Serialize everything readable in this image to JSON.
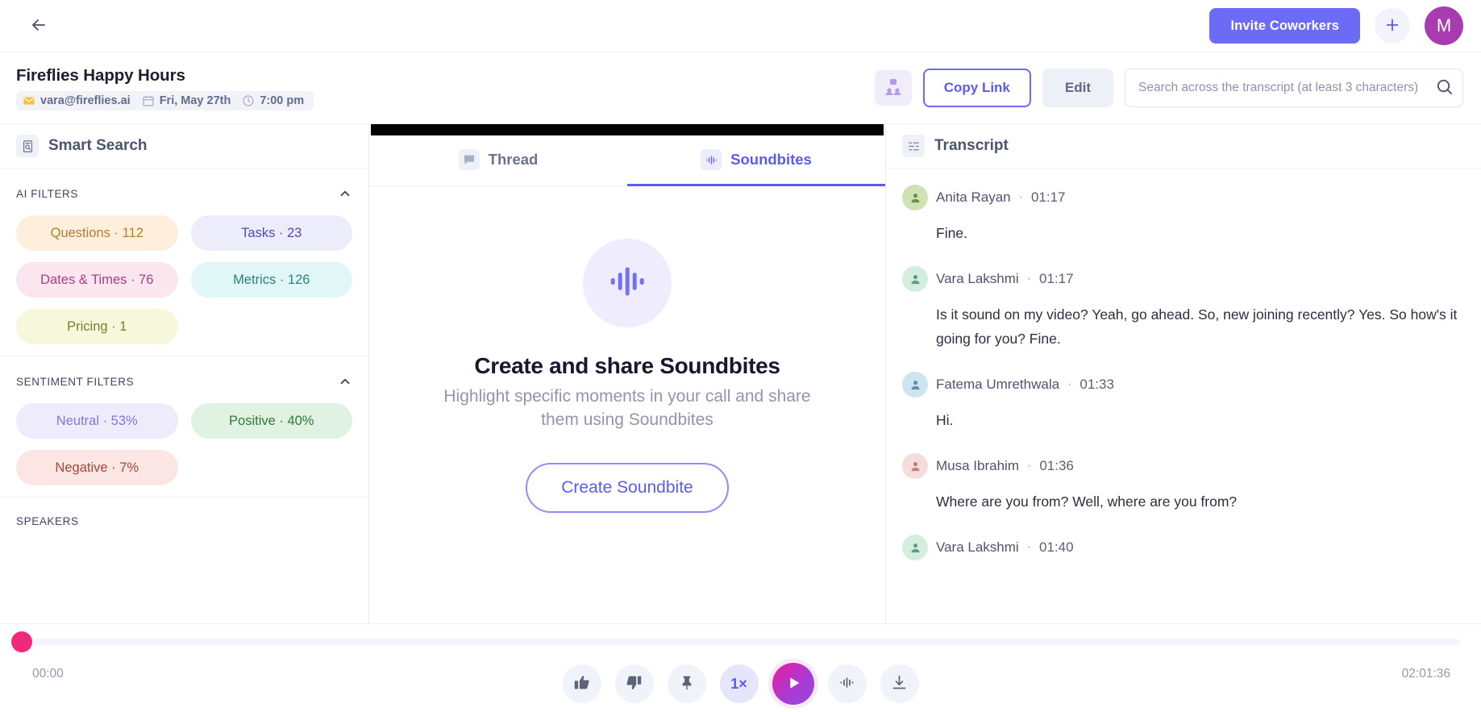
{
  "topbar": {
    "back_icon": "arrow-left-icon",
    "invite_label": "Invite Coworkers",
    "plus_icon": "plus-icon",
    "avatar_initial": "M",
    "accent": "#6b6bf5",
    "avatar_color": "#a93bb0"
  },
  "meeting": {
    "title": "Fireflies Happy Hours",
    "meta": [
      {
        "icon": "envelope-icon",
        "text": "vara@fireflies.ai"
      },
      {
        "icon": "calendar-icon",
        "text": "Fri, May 27th"
      },
      {
        "icon": "clock-icon",
        "text": "7:00 pm"
      }
    ],
    "share_icon": "share-people-icon",
    "copy_link_label": "Copy Link",
    "edit_label": "Edit",
    "search": {
      "placeholder": "Search across the transcript (at least 3 characters)",
      "value": "",
      "icon": "search-icon"
    }
  },
  "sidebar": {
    "header": {
      "icon": "smart-search-icon",
      "title": "Smart Search"
    },
    "sections": [
      {
        "label": "AI FILTERS",
        "chevron": "chevron-up-icon",
        "chips": [
          {
            "label": "Questions · 112",
            "bg": "#fdefdc",
            "fg": "#b1802f"
          },
          {
            "label": "Tasks · 23",
            "bg": "#ececfa",
            "fg": "#514bb5"
          },
          {
            "label": "Dates & Times · 76",
            "bg": "#fbe6f0",
            "fg": "#a6417c"
          },
          {
            "label": "Metrics · 126",
            "bg": "#e1f7f7",
            "fg": "#2f7d7d"
          },
          {
            "label": "Pricing · 1",
            "bg": "#f6f7db",
            "fg": "#7b7d2b"
          }
        ]
      },
      {
        "label": "SENTIMENT FILTERS",
        "chevron": "chevron-up-icon",
        "chips": [
          {
            "label": "Neutral · 53%",
            "bg": "#eeecfb",
            "fg": "#7a7ae0"
          },
          {
            "label": "Positive · 40%",
            "bg": "#e0f2e2",
            "fg": "#2f7a3c"
          },
          {
            "label": "Negative · 7%",
            "bg": "#fce6e4",
            "fg": "#a4453b"
          }
        ]
      },
      {
        "label": "SPEAKERS",
        "chevron": "chevron-up-icon",
        "chips": []
      }
    ]
  },
  "center": {
    "tabs": [
      {
        "label": "Thread",
        "icon": "thread-icon",
        "active": false
      },
      {
        "label": "Soundbites",
        "icon": "soundbite-waveform-icon",
        "active": true
      }
    ],
    "empty": {
      "icon": "soundbite-waveform-icon",
      "title": "Create and share Soundbites",
      "subtitle": "Highlight specific moments in your call and share them using Soundbites",
      "button_label": "Create Soundbite"
    }
  },
  "transcript": {
    "header": {
      "icon": "transcript-lines-icon",
      "title": "Transcript"
    },
    "entries": [
      {
        "speaker": "Anita Rayan",
        "time": "01:17",
        "text": "Fine.",
        "avatar_bg": "#cfe3b2",
        "avatar_fg": "#6f8d4c"
      },
      {
        "speaker": "Vara Lakshmi",
        "time": "01:17",
        "text": "Is it sound on my video? Yeah, go ahead. So, new joining recently? Yes. So how's it going for you? Fine.",
        "avatar_bg": "#d3eede",
        "avatar_fg": "#5f9c80"
      },
      {
        "speaker": "Fatema Umrethwala",
        "time": "01:33",
        "text": "Hi.",
        "avatar_bg": "#cde5ef",
        "avatar_fg": "#5b90a6"
      },
      {
        "speaker": "Musa Ibrahim",
        "time": "01:36",
        "text": "Where are you from? Well, where are you from?",
        "avatar_bg": "#f7dcdd",
        "avatar_fg": "#bf7e80"
      },
      {
        "speaker": "Vara Lakshmi",
        "time": "01:40",
        "text": "",
        "avatar_bg": "#d3eede",
        "avatar_fg": "#5f9c80"
      }
    ]
  },
  "player": {
    "current_time": "00:00",
    "total_time": "02:01:36",
    "progress_percent": 0,
    "playhead_color": "#ef2a7b",
    "controls": [
      {
        "name": "thumbs-up-icon",
        "label": ""
      },
      {
        "name": "thumbs-down-icon",
        "label": ""
      },
      {
        "name": "pin-icon",
        "label": ""
      },
      {
        "name": "playback-speed",
        "label": "1×"
      },
      {
        "name": "play-icon",
        "label": ""
      },
      {
        "name": "waveform-icon",
        "label": ""
      },
      {
        "name": "download-icon",
        "label": ""
      }
    ]
  }
}
